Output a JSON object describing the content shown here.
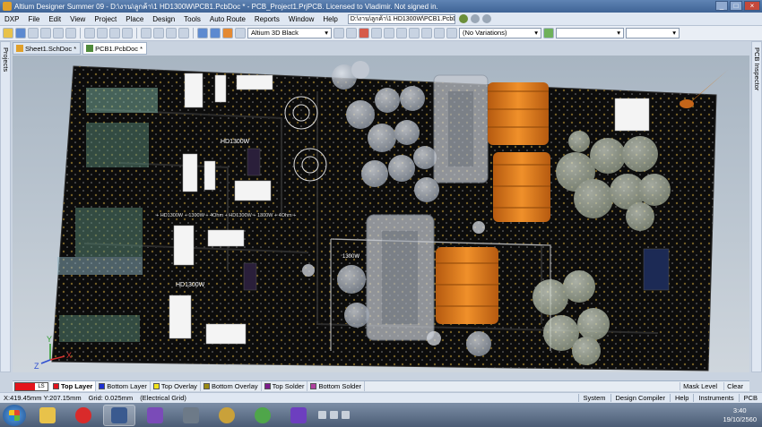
{
  "window": {
    "title": "Altium Designer Summer 09 - D:\\งาน\\ลูกค้า\\1 HD1300W\\PCB1.PcbDoc * - PCB_Project1.PrjPCB. Licensed to Vladimir. Not signed in.",
    "buttons": [
      "_",
      "□",
      "×"
    ]
  },
  "menu": {
    "items": [
      "DXP",
      "File",
      "Edit",
      "View",
      "Project",
      "Place",
      "Design",
      "Tools",
      "Auto Route",
      "Reports",
      "Window",
      "Help"
    ],
    "path": "D:\\งาน\\ลูกค้า\\1 HD1300W\\PCB1.PcbDoc"
  },
  "toolbar": {
    "view_config": "Altium 3D Black",
    "variations": "(No Variations)"
  },
  "panels": {
    "left": "Projects",
    "right": "PCB Inspector"
  },
  "doc_tabs": [
    {
      "label": "Sheet1.SchDoc *",
      "kind": "sch"
    },
    {
      "label": "PCB1.PcbDoc *",
      "kind": "pcb"
    }
  ],
  "board": {
    "silk_labels": [
      "HD1300W",
      "HD1300W",
      "1300W",
      "+ HD1300W + 1300W + 4Ohm + HD1300W + 1300W + 4Ohm +"
    ],
    "axis": {
      "x": "X",
      "y": "Y",
      "z": "Z"
    }
  },
  "layers": {
    "current_color": "#e3141c",
    "current_code": "LS",
    "tabs": [
      {
        "label": "Top Layer",
        "color": "#e3141c",
        "active": true
      },
      {
        "label": "Bottom Layer",
        "color": "#1b2fd1",
        "active": false
      },
      {
        "label": "Top Overlay",
        "color": "#f2e31a",
        "active": false
      },
      {
        "label": "Bottom Overlay",
        "color": "#9a8a12",
        "active": false
      },
      {
        "label": "Top Solder",
        "color": "#7d1c8c",
        "active": false
      },
      {
        "label": "Bottom Solder",
        "color": "#b0409f",
        "active": false
      }
    ],
    "right": [
      "Mask Level",
      "Clear"
    ]
  },
  "status": {
    "coords": "X:419.45mm Y:207.15mm",
    "grid": "Grid: 0.025mm",
    "mode": "(Electrical Grid)",
    "right": [
      "System",
      "Design Compiler",
      "Help",
      "Instruments",
      "PCB"
    ]
  },
  "taskbar": {
    "apps": [
      {
        "name": "explorer-app-icon",
        "color": "#e8c24a"
      },
      {
        "name": "opera-app-icon",
        "color": "#d92a2a"
      },
      {
        "name": "altium-app-icon",
        "color": "#3a5a8f"
      },
      {
        "name": "visual-studio-app-icon",
        "color": "#7a4bb8"
      },
      {
        "name": "calculator-app-icon",
        "color": "#6d7a88"
      },
      {
        "name": "paint-app-icon",
        "color": "#c9a13a"
      },
      {
        "name": "utorrent-app-icon",
        "color": "#4fa64a"
      },
      {
        "name": "twitch-app-icon",
        "color": "#6d3fbf"
      }
    ],
    "time": "3:40",
    "date": "19/10/2560"
  }
}
